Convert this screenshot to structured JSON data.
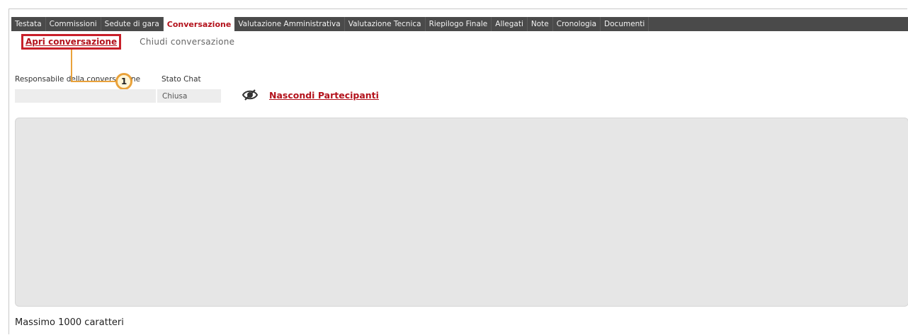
{
  "tabs": [
    {
      "label": "Testata",
      "active": false
    },
    {
      "label": "Commissioni",
      "active": false
    },
    {
      "label": "Sedute di gara",
      "active": false
    },
    {
      "label": "Conversazione",
      "active": true
    },
    {
      "label": "Valutazione Amministrativa",
      "active": false
    },
    {
      "label": "Valutazione Tecnica",
      "active": false
    },
    {
      "label": "Riepilogo Finale",
      "active": false
    },
    {
      "label": "Allegati",
      "active": false
    },
    {
      "label": "Note",
      "active": false
    },
    {
      "label": "Cronologia",
      "active": false
    },
    {
      "label": "Documenti",
      "active": false
    }
  ],
  "actions": {
    "open_label": "Apri conversazione",
    "close_label": "Chiudi conversazione"
  },
  "callout": {
    "number": "1"
  },
  "fields": {
    "responsabile_label": "Responsabile della conversazione",
    "responsabile_value": "",
    "stato_label": "Stato Chat",
    "stato_value": "Chiusa"
  },
  "participants": {
    "toggle_label": "Nascondi Partecipanti",
    "icon": "eye-hidden-icon"
  },
  "chat": {
    "char_limit_text": "Massimo 1000 caratteri"
  },
  "colors": {
    "tabbar": "#4a4a4a",
    "accent_red": "#b3121c",
    "callout": "#e9a23b",
    "field_bg": "#ededed"
  }
}
